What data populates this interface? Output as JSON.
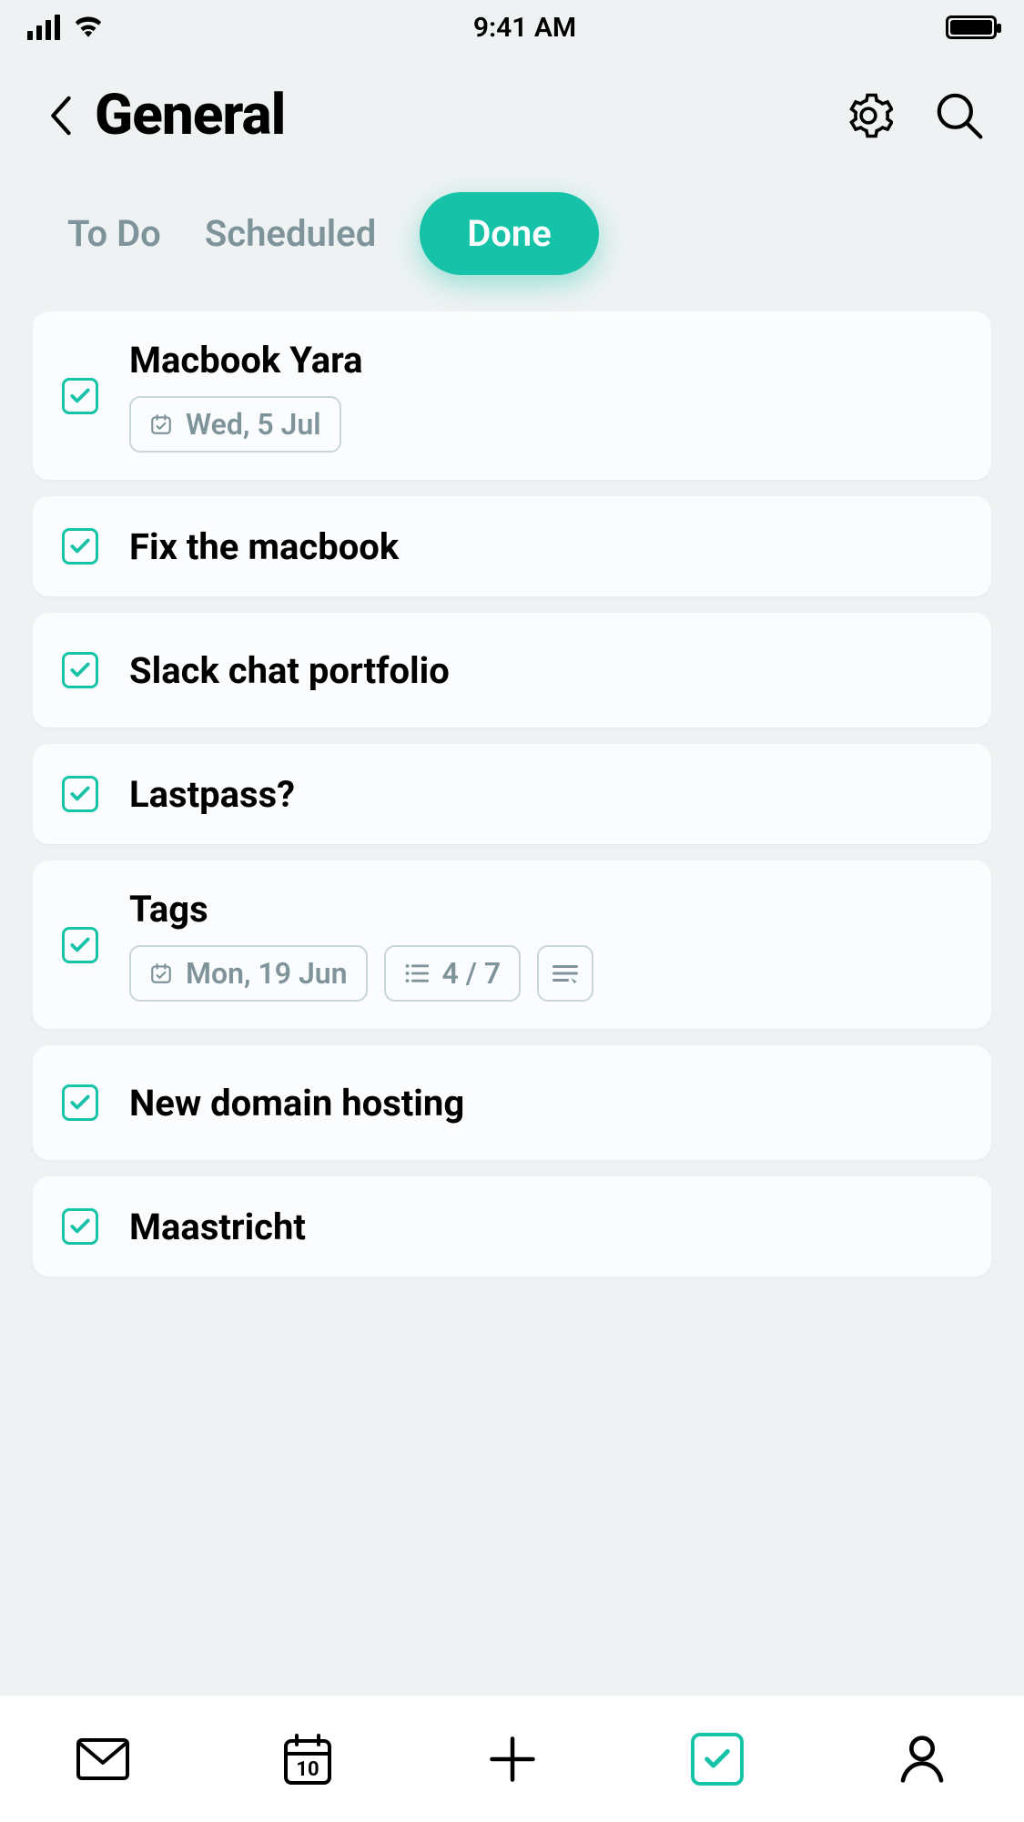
{
  "status": {
    "time": "9:41 AM"
  },
  "header": {
    "title": "General"
  },
  "tabs": [
    {
      "label": "To Do",
      "active": false
    },
    {
      "label": "Scheduled",
      "active": false
    },
    {
      "label": "Done",
      "active": true
    }
  ],
  "tasks": [
    {
      "title": "Macbook Yara",
      "date": "Wed, 5 Jul",
      "subtasks": null,
      "note": false
    },
    {
      "title": "Fix the macbook",
      "date": null,
      "subtasks": null,
      "note": false
    },
    {
      "title": "Slack chat portfolio",
      "date": null,
      "subtasks": null,
      "note": false
    },
    {
      "title": "Lastpass?",
      "date": null,
      "subtasks": null,
      "note": false
    },
    {
      "title": "Tags",
      "date": "Mon, 19 Jun",
      "subtasks": "4 / 7",
      "note": true
    },
    {
      "title": "New domain hosting",
      "date": null,
      "subtasks": null,
      "note": false
    },
    {
      "title": "Maastricht",
      "date": null,
      "subtasks": null,
      "note": false
    }
  ],
  "nav": {
    "calendar_day": "10"
  },
  "colors": {
    "accent": "#17c3a8",
    "muted": "#7e949a"
  }
}
